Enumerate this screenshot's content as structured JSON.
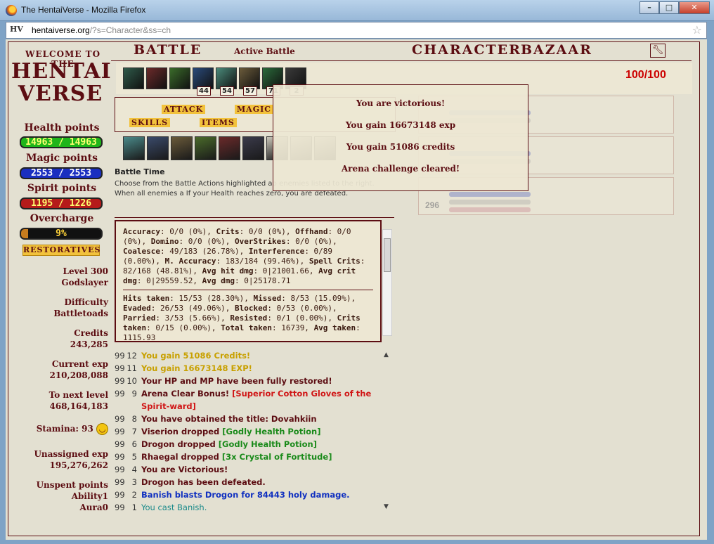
{
  "window": {
    "title": "The HentaiVerse - Mozilla Firefox",
    "minimize": "–",
    "maximize": "□",
    "close": "✕"
  },
  "urlbar": {
    "site_icon": "HV",
    "domain": "hentaiverse.org",
    "path": "/?s=Character&ss=ch"
  },
  "logo": {
    "welcome": "WELCOME TO THE",
    "line1": "HENTAI",
    "line2": "VERSE"
  },
  "vitals": {
    "health_label": "Health points",
    "health_value": "14963 / 14963",
    "magic_label": "Magic points",
    "magic_value": "2553 / 2553",
    "spirit_label": "Spirit points",
    "spirit_value": "1195 / 1226",
    "overcharge_label": "Overcharge",
    "overcharge_value": "9%",
    "overcharge_fraction": 0.09,
    "restoratives": "RESTORATIVES"
  },
  "character": {
    "level": "Level 300",
    "rank": "Godslayer",
    "difficulty_label": "Difficulty",
    "difficulty": "Battletoads",
    "credits_label": "Credits",
    "credits": "243,285",
    "exp_label": "Current exp",
    "exp": "210,208,088",
    "next_label": "To next level",
    "next": "468,164,183",
    "stamina_label": "Stamina: 93",
    "unassigned_label": "Unassigned exp",
    "unassigned": "195,276,262",
    "unspent_label": "Unspent points",
    "ability_label": "Ability",
    "ability": "1",
    "aura_label": "Aura",
    "aura": "0"
  },
  "nav": {
    "battle": "BATTLE",
    "active": "Active Battle",
    "character": "CHARACTER",
    "bazaar": "BAZAAR",
    "settings_icon": "wrench-icon"
  },
  "effects": [
    "",
    "",
    "",
    "44",
    "54",
    "57",
    "71",
    "2"
  ],
  "hp_counter": "100/100",
  "actions": {
    "attack": "ATTACK",
    "magic": "MAGIC",
    "skills": "SKILLS",
    "items": "ITEMS"
  },
  "battle_time": "Battle Time",
  "instructions_visible": "Choose from the Battle Actions highlighted ab enemies listed to the right. When all enemies a If your Health reaches zero, you are defeated.",
  "enemy": {
    "number": "296"
  },
  "popup": {
    "victory": "You are victorious!",
    "exp": "You gain 16673148 exp",
    "credits": "You gain 51086 credits",
    "arena": "Arena challenge cleared!"
  },
  "stats": {
    "offense": [
      [
        "Accuracy",
        ": 0/0 (0%), "
      ],
      [
        "Crits",
        ": 0/0 (0%), "
      ],
      [
        "Offhand",
        ": 0/0 (0%), "
      ],
      [
        "Domino",
        ": 0/0 (0%), "
      ],
      [
        "OverStrikes",
        ": 0/0 (0%), "
      ],
      [
        "Coalesce",
        ": 49/183 (26.78%), "
      ],
      [
        "Interference",
        ": 0/89 (0.00%), "
      ],
      [
        "M. Accuracy",
        ": 183/184 (99.46%), "
      ],
      [
        "Spell Crits",
        ": 82/168 (48.81%), "
      ],
      [
        "Avg hit dmg",
        ": 0|21001.66, "
      ],
      [
        "Avg crit dmg",
        ": 0|29559.52, "
      ],
      [
        "Avg dmg",
        ": 0|25178.71"
      ]
    ],
    "defense": [
      [
        "Hits taken",
        ": 15/53 (28.30%), "
      ],
      [
        "Missed",
        ": 8/53 (15.09%), "
      ],
      [
        "Evaded",
        ": 26/53 (49.06%), "
      ],
      [
        "Blocked",
        ": 0/53 (0.00%), "
      ],
      [
        "Parried",
        ": 3/53 (5.66%), "
      ],
      [
        "Resisted",
        ": 0/1 (0.00%), "
      ],
      [
        "Crits taken",
        ": 0/15 (0.00%), "
      ],
      [
        "Total taken",
        ": 16739, "
      ],
      [
        "Avg taken",
        ": 1115.93"
      ]
    ]
  },
  "log": [
    {
      "a": "99",
      "b": "12",
      "parts": [
        [
          "You gain 51086 Credits!",
          "gold"
        ]
      ]
    },
    {
      "a": "99",
      "b": "11",
      "parts": [
        [
          "You gain 16673148 EXP!",
          "gold"
        ]
      ]
    },
    {
      "a": "99",
      "b": "10",
      "parts": [
        [
          "Your HP and MP have been fully restored!",
          "dark"
        ]
      ]
    },
    {
      "a": "99",
      "b": "9",
      "parts": [
        [
          "Arena Clear Bonus! ",
          "dark"
        ],
        [
          "[Superior Cotton Gloves of the Spirit-ward]",
          "red"
        ]
      ]
    },
    {
      "a": "99",
      "b": "8",
      "parts": [
        [
          "You have obtained the title: Dovahkiin",
          "dark"
        ]
      ]
    },
    {
      "a": "99",
      "b": "7",
      "parts": [
        [
          "Viserion dropped ",
          "dark"
        ],
        [
          "[Godly Health Potion]",
          "green"
        ]
      ]
    },
    {
      "a": "99",
      "b": "6",
      "parts": [
        [
          "Drogon dropped ",
          "dark"
        ],
        [
          "[Godly Health Potion]",
          "green"
        ]
      ]
    },
    {
      "a": "99",
      "b": "5",
      "parts": [
        [
          "Rhaegal dropped ",
          "dark"
        ],
        [
          "[3x Crystal of Fortitude]",
          "green"
        ]
      ]
    },
    {
      "a": "99",
      "b": "4",
      "parts": [
        [
          "You are Victorious!",
          "dark"
        ]
      ]
    },
    {
      "a": "99",
      "b": "3",
      "parts": [
        [
          "Drogon has been defeated.",
          "dark"
        ]
      ]
    },
    {
      "a": "99",
      "b": "2",
      "parts": [
        [
          "Banish blasts Drogon for 84443 holy damage.",
          "blue"
        ]
      ]
    },
    {
      "a": "99",
      "b": "1",
      "parts": [
        [
          "You cast Banish.",
          "teal"
        ]
      ]
    }
  ],
  "colors": {
    "frame": "#5c0d12",
    "page_bg": "#e3e0d1",
    "hp_bar": "#1fb51a",
    "mp_bar": "#1a2fc0",
    "sp_bar": "#b51a1a",
    "log_gold": "#c8a000",
    "log_green": "#1a8a1a",
    "log_red": "#d01616",
    "log_blue": "#1030c0"
  }
}
